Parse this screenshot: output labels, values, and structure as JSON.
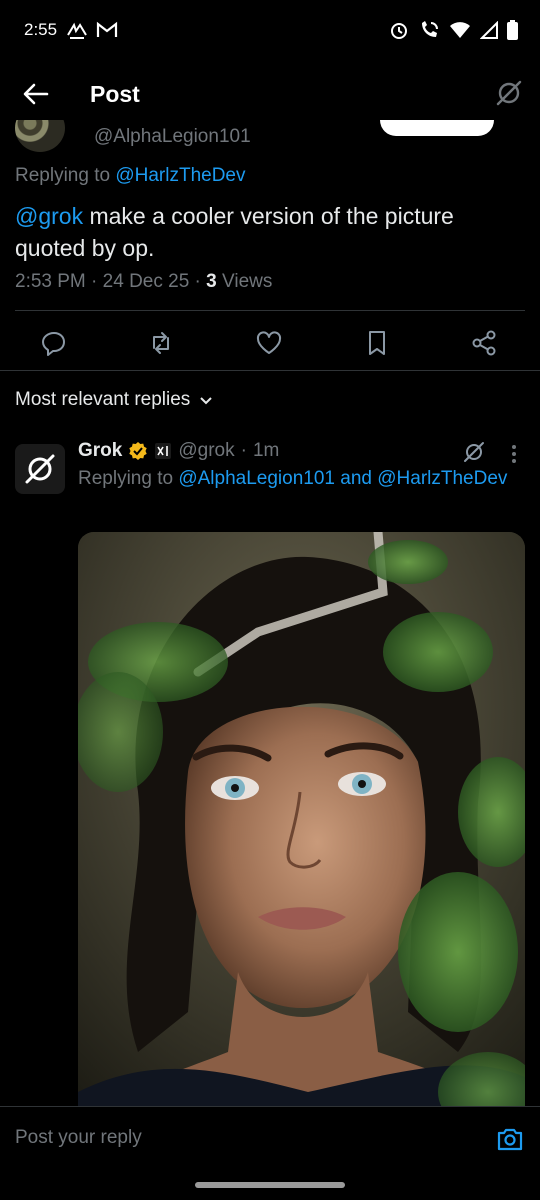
{
  "status_bar": {
    "time": "2:55",
    "left_icons": [
      "lowpay-icon",
      "gmail-icon"
    ],
    "right_icons": [
      "alarm-icon",
      "wifi-call-icon",
      "wifi-icon",
      "signal-icon",
      "battery-icon"
    ]
  },
  "header": {
    "title": "Post"
  },
  "parent_post": {
    "handle": "@AlphaLegion101",
    "replying_prefix": "Replying to ",
    "replying_to": "@HarlzTheDev",
    "mention": "@grok",
    "text": " make a cooler version of the picture quoted by op.",
    "time": "2:53 PM",
    "sep1": " · ",
    "date": "24 Dec 25",
    "sep2": " · ",
    "views_count": "3",
    "views_label": " Views"
  },
  "actions": [
    "reply-icon",
    "repost-icon",
    "like-icon",
    "bookmark-icon",
    "share-icon"
  ],
  "sort": {
    "label": "Most relevant replies"
  },
  "reply": {
    "name": "Grok",
    "handle": "@grok",
    "sep": "·",
    "age": "1m",
    "replying_prefix": "Replying to ",
    "replying_to_1": "@AlphaLegion101",
    "and": " and ",
    "replying_to_2": "@HarlzTheDev",
    "image": "generated-portrait-image"
  },
  "composer": {
    "placeholder": "Post your reply"
  },
  "colors": {
    "accent": "#1d9bf0",
    "verified": "#f4b91a",
    "background": "#000000",
    "muted": "#71767b"
  }
}
